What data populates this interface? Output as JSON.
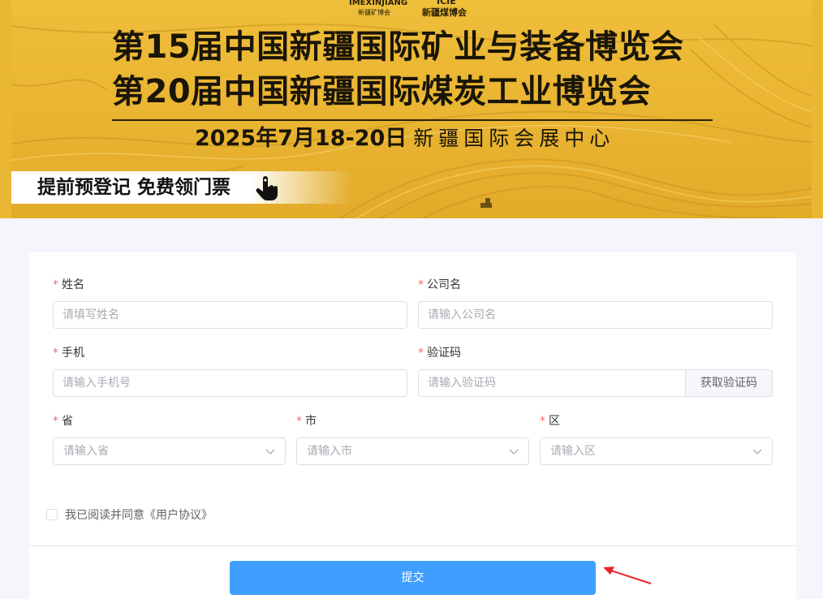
{
  "banner": {
    "logo1_en": "IMEXINJIANG",
    "logo1_cn": "新疆矿博会",
    "logo2_en": "ICIE",
    "logo2_cn": "新疆煤博会",
    "title_line1": "第15届中国新疆国际矿业与装备博览会",
    "title_line2": "第20届中国新疆国际煤炭工业博览会",
    "date": "2025年7月18-20日",
    "venue": "新疆国际会展中心",
    "cta": "提前预登记 免费领门票",
    "colors": {
      "gold": "#e9b431",
      "ink": "#1a1508"
    }
  },
  "form": {
    "name": {
      "label": "姓名",
      "placeholder": "请填写姓名",
      "value": ""
    },
    "company": {
      "label": "公司名",
      "placeholder": "请输入公司名",
      "value": ""
    },
    "phone": {
      "label": "手机",
      "placeholder": "请输入手机号",
      "value": ""
    },
    "code": {
      "label": "验证码",
      "placeholder": "请输入验证码",
      "value": "",
      "button": "获取验证码"
    },
    "province": {
      "label": "省",
      "placeholder": "请输入省"
    },
    "city": {
      "label": "市",
      "placeholder": "请输入市"
    },
    "district": {
      "label": "区",
      "placeholder": "请输入区"
    },
    "required_mark": "*",
    "agreement": {
      "text": "我已阅读并同意《用户协议》",
      "checked": false
    },
    "submit_label": "提交"
  },
  "icons": [
    "hand-pointer-icon",
    "chevron-down-icon",
    "red-arrow-icon"
  ],
  "colors": {
    "primary": "#409eff",
    "required": "#f56c6c",
    "annotation": "#e8262a"
  }
}
